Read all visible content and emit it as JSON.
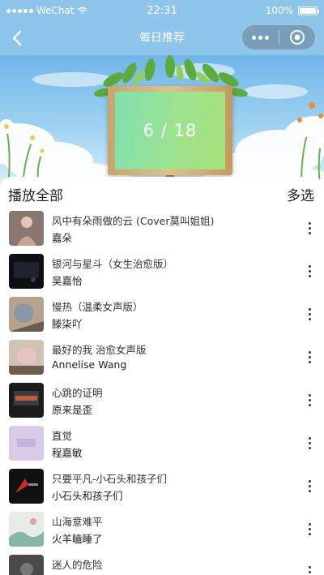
{
  "status_bar": {
    "carrier": "WeChat",
    "time": "22:31",
    "battery": "100%",
    "battery_level": 1.0
  },
  "nav": {
    "title": "每日推荐",
    "back_icon": "chevron-left-icon",
    "more_icon": "more-dots-icon",
    "close_icon": "target-circle-icon"
  },
  "banner": {
    "counter": "6 / 18"
  },
  "list": {
    "play_all_label": "播放全部",
    "multi_select_label": "多选",
    "songs": [
      {
        "title": "风中有朵雨做的云 (Cover莫叫姐姐)",
        "artist": "嘉朵"
      },
      {
        "title": "银河与星斗（女生治愈版）",
        "artist": "吴嘉怡"
      },
      {
        "title": "慢热（温柔女声版）",
        "artist": "滕柒吖"
      },
      {
        "title": "最好的我 治愈女声版",
        "artist": "Annelise Wang"
      },
      {
        "title": "心跳的证明",
        "artist": "原来是歪"
      },
      {
        "title": "直觉",
        "artist": "程嘉敏"
      },
      {
        "title": "只要平凡-小石头和孩子们",
        "artist": "小石头和孩子们"
      },
      {
        "title": "山海意难平",
        "artist": "火羊瞌睡了"
      },
      {
        "title": "迷人的危险",
        "artist": ""
      }
    ]
  },
  "colors": {
    "nav_background": "#8ec5ea",
    "text_primary": "#222222",
    "banner_board_green": "#9ee38f"
  }
}
